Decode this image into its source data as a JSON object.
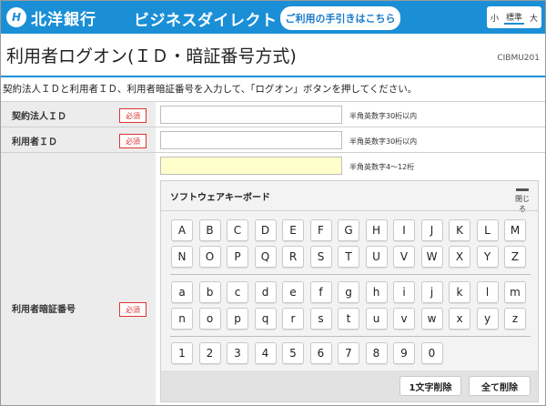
{
  "header": {
    "logo_mark": "H",
    "bank_name": "北洋銀行",
    "service_name": "ビジネスダイレクト",
    "guide_button": "ご利用の手引きはこちら",
    "font_sizes": [
      "小",
      "標準",
      "大"
    ],
    "brand_color": "#1a8fd6"
  },
  "page": {
    "title": "利用者ログオン(ＩＤ・暗証番号方式)",
    "id": "CIBMU201",
    "instruction": "契約法人ＩＤと利用者ＩＤ、利用者暗証番号を入力して、「ログオン」ボタンを押してください。"
  },
  "form": {
    "required_label": "必須",
    "contract_id": {
      "label": "契約法人ＩＤ",
      "value": "",
      "hint": "半角英数字30桁以内"
    },
    "user_id": {
      "label": "利用者ＩＤ",
      "value": "",
      "hint": "半角英数字30桁以内"
    },
    "password": {
      "label": "利用者暗証番号",
      "value": "",
      "hint": "半角英数字4～12桁"
    }
  },
  "keyboard": {
    "title": "ソフトウェアキーボード",
    "close_label": "閉じる",
    "upper_row1": [
      "A",
      "B",
      "C",
      "D",
      "E",
      "F",
      "G",
      "H",
      "I",
      "J",
      "K",
      "L",
      "M"
    ],
    "upper_row2": [
      "N",
      "O",
      "P",
      "Q",
      "R",
      "S",
      "T",
      "U",
      "V",
      "W",
      "X",
      "Y",
      "Z"
    ],
    "lower_row1": [
      "a",
      "b",
      "c",
      "d",
      "e",
      "f",
      "g",
      "h",
      "i",
      "j",
      "k",
      "l",
      "m"
    ],
    "lower_row2": [
      "n",
      "o",
      "p",
      "q",
      "r",
      "s",
      "t",
      "u",
      "v",
      "w",
      "x",
      "y",
      "z"
    ],
    "digits": [
      "1",
      "2",
      "3",
      "4",
      "5",
      "6",
      "7",
      "8",
      "9",
      "0"
    ],
    "delete_one": "1文字削除",
    "delete_all": "全て削除"
  }
}
